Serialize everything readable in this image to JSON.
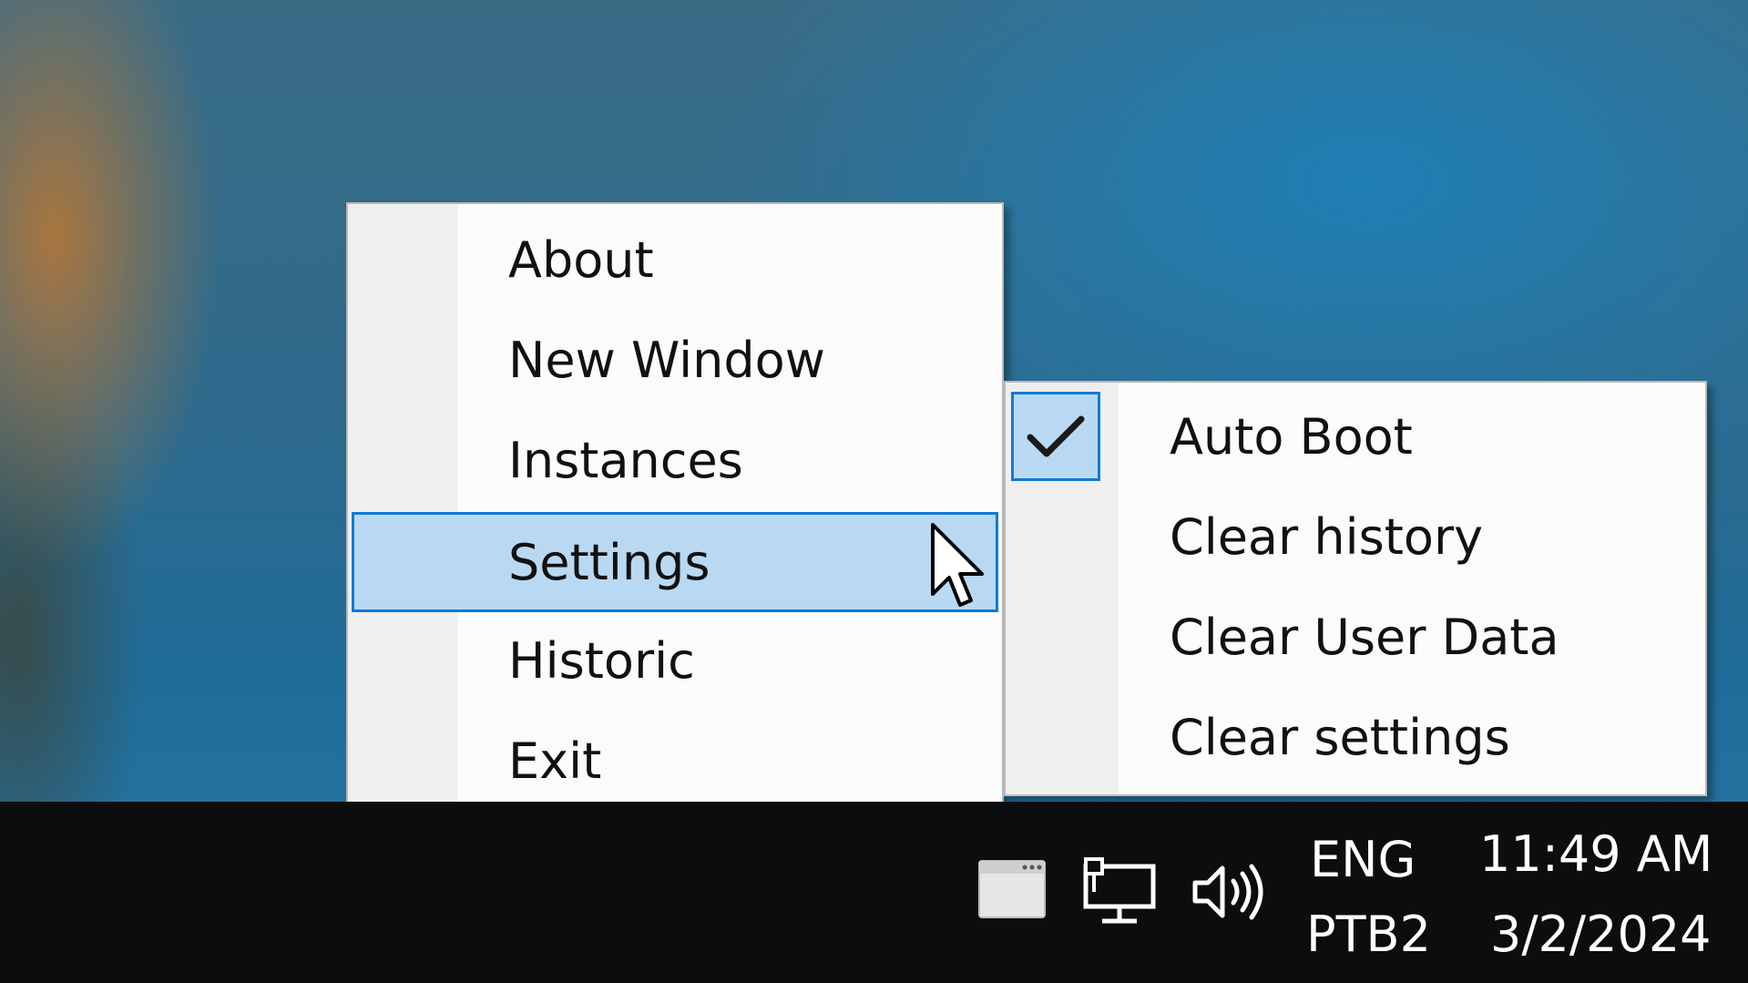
{
  "main_menu": {
    "items": [
      {
        "label": "About"
      },
      {
        "label": "New Window"
      },
      {
        "label": "Instances"
      },
      {
        "label": "Settings",
        "highlighted": true,
        "has_submenu": true
      },
      {
        "label": "Historic"
      },
      {
        "label": "Exit"
      }
    ]
  },
  "settings_submenu": {
    "items": [
      {
        "label": "Auto Boot",
        "checked": true
      },
      {
        "label": "Clear history"
      },
      {
        "label": "Clear User Data"
      },
      {
        "label": "Clear settings"
      }
    ]
  },
  "taskbar": {
    "tray_icons": [
      "app-window-icon",
      "network-icon",
      "volume-icon"
    ],
    "language": "ENG",
    "keyboard_layout": "PTB2",
    "time": "11:49 AM",
    "date": "3/2/2024"
  },
  "colors": {
    "highlight_fill": "#b9d9f3",
    "highlight_border": "#0f7bd6",
    "taskbar_bg": "#0c0d0e"
  }
}
